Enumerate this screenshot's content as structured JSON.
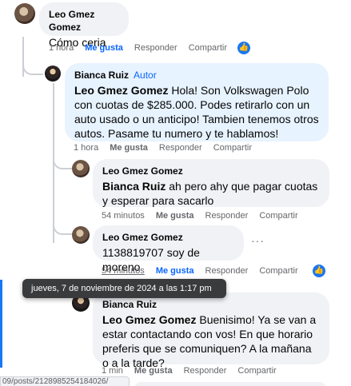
{
  "comments": [
    {
      "author": "Leo Gmez Gomez",
      "text": "Cómo ceria",
      "time": "1 hora",
      "like": "Me gusta",
      "reply": "Responder",
      "share": "Compartir"
    },
    {
      "author": "Bianca Ruiz",
      "badge": "Autor",
      "mention": "Leo Gmez Gomez",
      "text": " Hola! Son Volkswagen Polo con cuotas de $285.000. Podes retirarlo con un auto usado o un anticipo! Tambien tenemos otros autos. Pasame tu numero y te hablamos!",
      "time": "1 hora",
      "like": "Me gusta",
      "reply": "Responder",
      "share": "Compartir"
    },
    {
      "author": "Leo Gmez Gomez",
      "mention": "Bianca Ruiz",
      "text": " ah pero ahy que pagar cuotas y esperar para sacarlo",
      "time": "54 minutos",
      "like": "Me gusta",
      "reply": "Responder",
      "share": "Compartir"
    },
    {
      "author": "Leo Gmez Gomez",
      "text": "1138819707 soy de moreno",
      "time": "54 minutos",
      "like": "Me gusta",
      "reply": "Responder",
      "share": "Compartir",
      "more": "···"
    },
    {
      "author": "Bianca Ruiz",
      "mention": "Leo Gmez Gomez",
      "text": " Buenisimo! Ya se van a estar contactando con vos! En que horario preferis que se comuniquen? A la mañana o a la tarde?",
      "time": "1 min",
      "like": "Me gusta",
      "reply": "Responder",
      "share": "Compartir"
    }
  ],
  "tooltip": "jueves, 7 de noviembre de 2024 a las 1:17 pm",
  "status_url": "09/posts/2128985254184026/",
  "colors": {
    "accent": "#0866ff",
    "bubble": "#f0f2f5",
    "highlight": "#e7f3ff"
  }
}
